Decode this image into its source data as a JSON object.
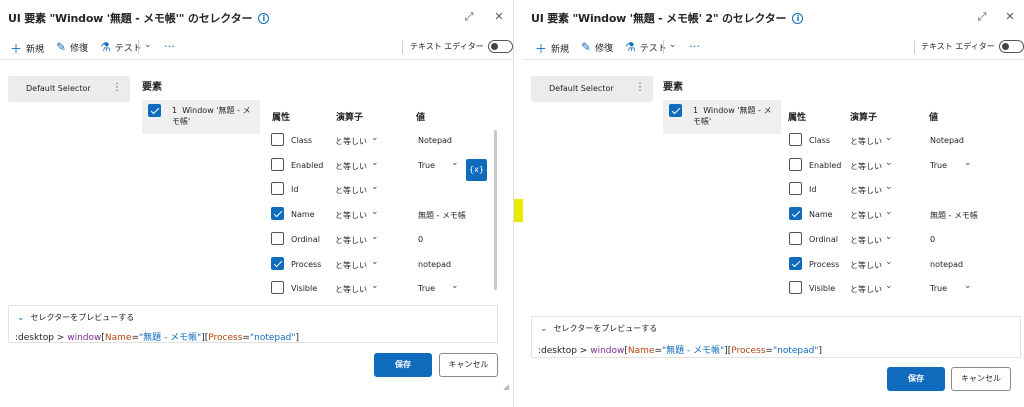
{
  "dialogs": [
    {
      "title": "UI 要素 \"Window '無題 - メモ帳'\" のセレクター",
      "info_icon": "i",
      "expand_icon": "⤢",
      "close_icon": "✕",
      "toolbar": {
        "new_label": "新規",
        "repair_label": "修復",
        "test_label": "テスト",
        "more": "…",
        "text_editor_label": "テキスト エディター",
        "text_editor_on": false
      },
      "selector_name": "Default Selector",
      "elements_title": "要素",
      "element": {
        "index": "1",
        "label": "Window '無題 - メモ帳'",
        "checked": true
      },
      "headers": {
        "attribute": "属性",
        "operator": "演算子",
        "value": "値"
      },
      "attributes": [
        {
          "name": "Class",
          "operator": "と等しい",
          "value": "Notepad",
          "checked": false,
          "value_dropdown": false
        },
        {
          "name": "Enabled",
          "operator": "と等しい",
          "value": "True",
          "checked": false,
          "value_dropdown": true
        },
        {
          "name": "Id",
          "operator": "と等しい",
          "value": "",
          "checked": false,
          "value_dropdown": false
        },
        {
          "name": "Name",
          "operator": "と等しい",
          "value": "無題 - メモ帳",
          "checked": true,
          "value_dropdown": false
        },
        {
          "name": "Ordinal",
          "operator": "と等しい",
          "value": "0",
          "checked": false,
          "value_dropdown": false
        },
        {
          "name": "Process",
          "operator": "と等しい",
          "value": "notepad",
          "checked": true,
          "value_dropdown": false
        },
        {
          "name": "Visible",
          "operator": "と等しい",
          "value": "True",
          "checked": false,
          "value_dropdown": true
        }
      ],
      "variable_button": "{x}",
      "preview": {
        "label": "セレクターをプレビューする",
        "code": [
          ":desktop > ",
          "window",
          "[",
          "Name",
          "=",
          "\"無題 - メモ帳\"",
          "][",
          "Process",
          "=",
          "\"notepad\"",
          "]"
        ]
      },
      "save_label": "保存",
      "cancel_label": "キャンセル"
    },
    {
      "title": "UI 要素 \"Window '無題 - メモ帳' 2\" のセレクター",
      "info_icon": "i",
      "expand_icon": "⤢",
      "close_icon": "✕",
      "toolbar": {
        "new_label": "新規",
        "repair_label": "修復",
        "test_label": "テスト",
        "more": "…",
        "text_editor_label": "テキスト エディター",
        "text_editor_on": false
      },
      "selector_name": "Default Selector",
      "elements_title": "要素",
      "element": {
        "index": "1",
        "label": "Window '無題 - メモ帳'",
        "checked": true
      },
      "headers": {
        "attribute": "属性",
        "operator": "演算子",
        "value": "値"
      },
      "attributes": [
        {
          "name": "Class",
          "operator": "と等しい",
          "value": "Notepad",
          "checked": false,
          "value_dropdown": false
        },
        {
          "name": "Enabled",
          "operator": "と等しい",
          "value": "True",
          "checked": false,
          "value_dropdown": true
        },
        {
          "name": "Id",
          "operator": "と等しい",
          "value": "",
          "checked": false,
          "value_dropdown": false
        },
        {
          "name": "Name",
          "operator": "と等しい",
          "value": "無題 - メモ帳",
          "checked": true,
          "value_dropdown": false
        },
        {
          "name": "Ordinal",
          "operator": "と等しい",
          "value": "0",
          "checked": false,
          "value_dropdown": false
        },
        {
          "name": "Process",
          "operator": "と等しい",
          "value": "notepad",
          "checked": true,
          "value_dropdown": false
        },
        {
          "name": "Visible",
          "operator": "と等しい",
          "value": "True",
          "checked": false,
          "value_dropdown": true
        }
      ],
      "preview": {
        "label": "セレクターをプレビューする",
        "code": [
          ":desktop > ",
          "window",
          "[",
          "Name",
          "=",
          "\"無題 - メモ帳\"",
          "][",
          "Process",
          "=",
          "\"notepad\"",
          "]"
        ]
      },
      "save_label": "保存",
      "cancel_label": "キャンセル"
    }
  ],
  "colors": {
    "accent": "#0f6cbd",
    "highlight": "#e8ea00"
  }
}
